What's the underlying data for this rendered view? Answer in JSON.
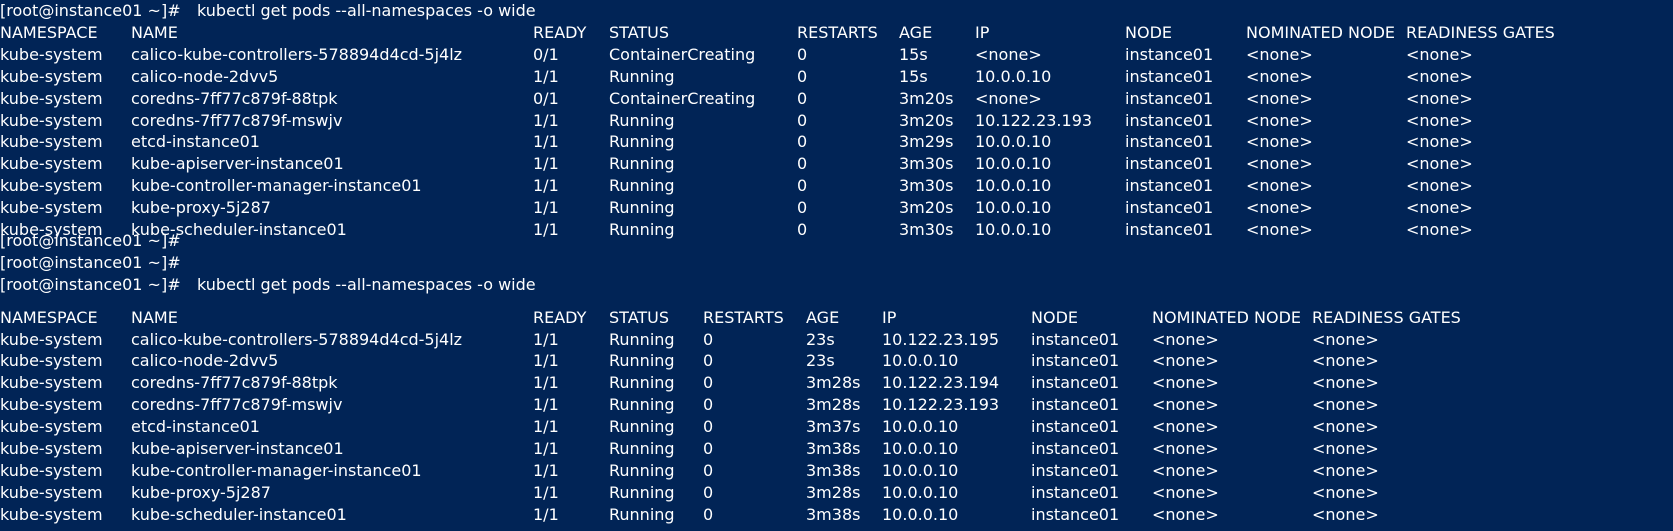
{
  "terminal": {
    "background": "#012456",
    "foreground": "#ffffff",
    "first_command": {
      "prompt": "[root@instance01 ~]#",
      "command": "kubectl get pods --all-namespaces -o wide"
    },
    "first_table": {
      "headers": [
        "NAMESPACE",
        "NAME",
        "READY",
        "STATUS",
        "RESTARTS",
        "AGE",
        "IP",
        "NODE",
        "NOMINATED NODE",
        "READINESS GATES"
      ],
      "rows": [
        [
          "kube-system",
          "calico-kube-controllers-578894d4cd-5j4lz",
          "0/1",
          "ContainerCreating",
          "0",
          "15s",
          "<none>",
          "instance01",
          "<none>",
          "<none>"
        ],
        [
          "kube-system",
          "calico-node-2dvv5",
          "1/1",
          "Running",
          "0",
          "15s",
          "10.0.0.10",
          "instance01",
          "<none>",
          "<none>"
        ],
        [
          "kube-system",
          "coredns-7ff77c879f-88tpk",
          "0/1",
          "ContainerCreating",
          "0",
          "3m20s",
          "<none>",
          "instance01",
          "<none>",
          "<none>"
        ],
        [
          "kube-system",
          "coredns-7ff77c879f-mswjv",
          "1/1",
          "Running",
          "0",
          "3m20s",
          "10.122.23.193",
          "instance01",
          "<none>",
          "<none>"
        ],
        [
          "kube-system",
          "etcd-instance01",
          "1/1",
          "Running",
          "0",
          "3m29s",
          "10.0.0.10",
          "instance01",
          "<none>",
          "<none>"
        ],
        [
          "kube-system",
          "kube-apiserver-instance01",
          "1/1",
          "Running",
          "0",
          "3m30s",
          "10.0.0.10",
          "instance01",
          "<none>",
          "<none>"
        ],
        [
          "kube-system",
          "kube-controller-manager-instance01",
          "1/1",
          "Running",
          "0",
          "3m30s",
          "10.0.0.10",
          "instance01",
          "<none>",
          "<none>"
        ],
        [
          "kube-system",
          "kube-proxy-5j287",
          "1/1",
          "Running",
          "0",
          "3m20s",
          "10.0.0.10",
          "instance01",
          "<none>",
          "<none>"
        ],
        [
          "kube-system",
          "kube-scheduler-instance01",
          "1/1",
          "Running",
          "0",
          "3m30s",
          "10.0.0.10",
          "instance01",
          "<none>",
          "<none>"
        ]
      ]
    },
    "empty_prompts": [
      "[root@instance01 ~]#",
      "[root@instance01 ~]#"
    ],
    "second_command": {
      "prompt": "[root@instance01 ~]#",
      "command": "kubectl get pods --all-namespaces -o wide"
    },
    "second_table": {
      "headers": [
        "NAMESPACE",
        "NAME",
        "READY",
        "STATUS",
        "RESTARTS",
        "AGE",
        "IP",
        "NODE",
        "NOMINATED NODE",
        "READINESS GATES"
      ],
      "rows": [
        [
          "kube-system",
          "calico-kube-controllers-578894d4cd-5j4lz",
          "1/1",
          "Running",
          "0",
          "23s",
          "10.122.23.195",
          "instance01",
          "<none>",
          "<none>"
        ],
        [
          "kube-system",
          "calico-node-2dvv5",
          "1/1",
          "Running",
          "0",
          "23s",
          "10.0.0.10",
          "instance01",
          "<none>",
          "<none>"
        ],
        [
          "kube-system",
          "coredns-7ff77c879f-88tpk",
          "1/1",
          "Running",
          "0",
          "3m28s",
          "10.122.23.194",
          "instance01",
          "<none>",
          "<none>"
        ],
        [
          "kube-system",
          "coredns-7ff77c879f-mswjv",
          "1/1",
          "Running",
          "0",
          "3m28s",
          "10.122.23.193",
          "instance01",
          "<none>",
          "<none>"
        ],
        [
          "kube-system",
          "etcd-instance01",
          "1/1",
          "Running",
          "0",
          "3m37s",
          "10.0.0.10",
          "instance01",
          "<none>",
          "<none>"
        ],
        [
          "kube-system",
          "kube-apiserver-instance01",
          "1/1",
          "Running",
          "0",
          "3m38s",
          "10.0.0.10",
          "instance01",
          "<none>",
          "<none>"
        ],
        [
          "kube-system",
          "kube-controller-manager-instance01",
          "1/1",
          "Running",
          "0",
          "3m38s",
          "10.0.0.10",
          "instance01",
          "<none>",
          "<none>"
        ],
        [
          "kube-system",
          "kube-proxy-5j287",
          "1/1",
          "Running",
          "0",
          "3m28s",
          "10.0.0.10",
          "instance01",
          "<none>",
          "<none>"
        ],
        [
          "kube-system",
          "kube-scheduler-instance01",
          "1/1",
          "Running",
          "0",
          "3m38s",
          "10.0.0.10",
          "instance01",
          "<none>",
          "<none>"
        ]
      ]
    }
  }
}
